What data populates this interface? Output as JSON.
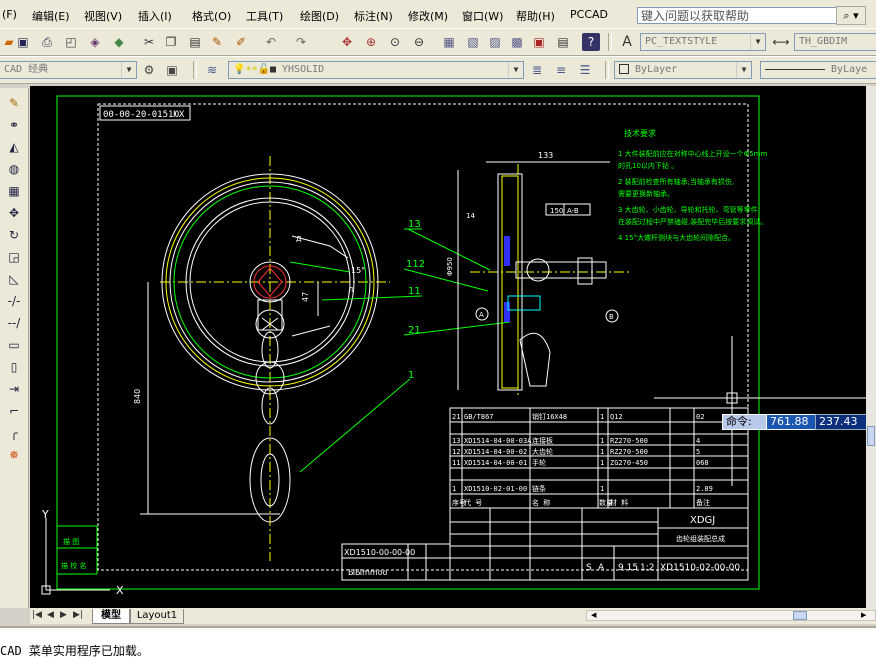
{
  "menu": {
    "items": [
      "(F)",
      "编辑(E)",
      "视图(V)",
      "插入(I)",
      "格式(O)",
      "工具(T)",
      "绘图(D)",
      "标注(N)",
      "修改(M)",
      "窗口(W)",
      "帮助(H)",
      "PCCAD"
    ],
    "help_placeholder": "键入问题以获取帮助",
    "search_icon": "search-icon"
  },
  "toolbar1": {
    "text_style": "PC_TEXTSTYLE",
    "dim_style": "TH_GBDIM"
  },
  "toolbar2": {
    "workspace": "CAD 经典",
    "layer": "YHSOLID",
    "color": "ByLayer",
    "linetype": "ByLaye"
  },
  "drawing": {
    "frame_code": "00-00-20-0151ЮX",
    "tech_title": "技术要求",
    "tech_notes": [
      "1 大件装配前应在对称中心线上开设一个Φ5mm",
      "  的孔10以内下钻 。",
      "2 装配前检查所有轴承,当轴承有损伤,",
      "  需要更换新轴承。",
      "3 大齿轮、小齿轮、导轮和托轮、弯管等零件",
      "  在装配过程中严禁磕碰,装配完毕后按要求调试。",
      "4 15°大螺杆侧块与大齿轮间隙配合。"
    ],
    "dims": {
      "width_133": "133",
      "dim_840": "840",
      "dim_47": "47",
      "dim_15deg": "15°",
      "dim_14": "14",
      "dim_d950": "Φ950",
      "box_150": "150",
      "box_ab": "A-B"
    },
    "balloons": [
      "13",
      "112",
      "11",
      "21",
      "1",
      "Д",
      "Л"
    ],
    "bom_rows": [
      {
        "no": "21",
        "code": "GB/T867",
        "name": "销钉16X48",
        "qty": "1",
        "mat": "Q12",
        "note": "02"
      },
      {
        "no": "13",
        "code": "XD1514-04-00-03A",
        "name": "连接板",
        "qty": "1",
        "mat": "RZ270-500",
        "note": "4"
      },
      {
        "no": "12",
        "code": "XD1514-04-00-02",
        "name": "大齿轮",
        "qty": "1",
        "mat": "RZ270-500",
        "note": "5"
      },
      {
        "no": "11",
        "code": "XD1514-04-00-01",
        "name": "手轮",
        "qty": "1",
        "mat": "ZG270-450",
        "note": "068"
      },
      {
        "no": "1",
        "code": "XD1510-02-01-00",
        "name": "链条",
        "qty": "1",
        "mat": "",
        "note": "2.89"
      }
    ],
    "bom_header": [
      "序号",
      "代 号",
      "名 称",
      "数量",
      "材 料",
      "备注"
    ],
    "title_block": {
      "company": "XDGJ",
      "product": "齿轮组装配总成",
      "drawing_no": "XD1510-02-00-00",
      "stage": "S",
      "stage2": "A",
      "weight": "9.15",
      "scale": "1:2"
    },
    "side_labels": [
      "描 图",
      "描 校 名"
    ],
    "left_block": {
      "code": "XD1510-00-00-00",
      "sub": "ЫЫmmoo"
    },
    "ucs_x": "X",
    "ucs_y": "Y"
  },
  "cmd": {
    "prompt": "命令:",
    "x": "761.88",
    "y": "237.43",
    "message": "CAD 菜单实用程序已加载。"
  },
  "tabs": {
    "model": "模型",
    "layout1": "Layout1"
  },
  "colors": {
    "canvas": "#000000",
    "green": "#00ff00",
    "yellow": "#ffff00",
    "white": "#ffffff",
    "blue": "#3030ff",
    "red": "#ff3030",
    "cyan": "#00ffff"
  }
}
